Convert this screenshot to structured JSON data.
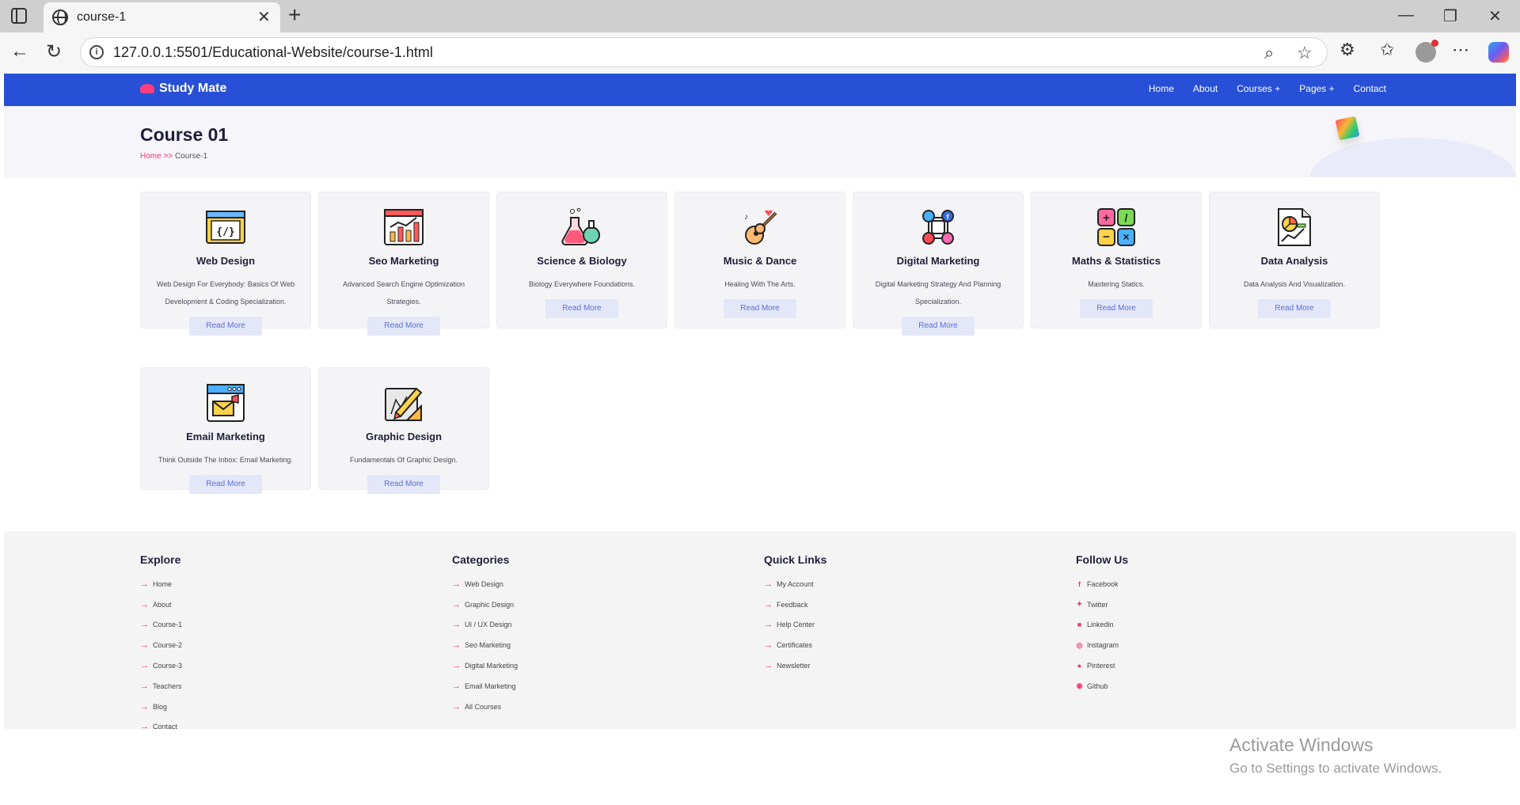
{
  "browser": {
    "tab_title": "course-1",
    "url": "127.0.0.1:5501/Educational-Website/course-1.html"
  },
  "site": {
    "logo": "Study Mate",
    "nav": [
      "Home",
      "About",
      "Courses +",
      "Pages +",
      "Contact"
    ],
    "page_title": "Course 01",
    "breadcrumb": {
      "home": "Home",
      "sep": ">>",
      "current": "Course-1"
    }
  },
  "courses": [
    {
      "title": "Web Design",
      "desc": "Web Design For Everybody: Basics Of Web Development & Coding Specialization.",
      "button": "Read More",
      "icon": "code-window-icon"
    },
    {
      "title": "Seo Marketing",
      "desc": "Advanced Search Engine Optimization Strategies.",
      "button": "Read More",
      "icon": "seo-chart-icon"
    },
    {
      "title": "Science & Biology",
      "desc": "Biology Everywhere Foundations.",
      "button": "Read More",
      "icon": "flask-icon"
    },
    {
      "title": "Music & Dance",
      "desc": "Healing With The Arts.",
      "button": "Read More",
      "icon": "guitar-icon"
    },
    {
      "title": "Digital Marketing",
      "desc": "Digital Marketing Strategy And Planning Specialization.",
      "button": "Read More",
      "icon": "social-network-icon"
    },
    {
      "title": "Maths & Statistics",
      "desc": "Mastering Statics.",
      "button": "Read More",
      "icon": "calculator-icon"
    },
    {
      "title": "Data Analysis",
      "desc": "Data Analysis And Visualization.",
      "button": "Read More",
      "icon": "data-report-icon"
    },
    {
      "title": "Email Marketing",
      "desc": "Think Outside The Inbox: Email Marketing.",
      "button": "Read More",
      "icon": "email-icon"
    },
    {
      "title": "Graphic Design",
      "desc": "Fundamentals Of Graphic Design.",
      "button": "Read More",
      "icon": "design-tools-icon"
    }
  ],
  "footer": {
    "explore": {
      "title": "Explore",
      "items": [
        "Home",
        "About",
        "Course-1",
        "Course-2",
        "Course-3",
        "Teachers",
        "Blog",
        "Contact"
      ]
    },
    "categories": {
      "title": "Categories",
      "items": [
        "Web Design",
        "Graphic Design",
        "UI / UX Design",
        "Seo Marketing",
        "Digital Marketing",
        "Email Marketing",
        "All Courses"
      ]
    },
    "quick_links": {
      "title": "Quick Links",
      "items": [
        "My Account",
        "Feedback",
        "Help Center",
        "Certificates",
        "Newsletter"
      ]
    },
    "follow": {
      "title": "Follow Us",
      "items": [
        "Facebook",
        "Twitter",
        "Linkedin",
        "Instagram",
        "Pinterest",
        "Github"
      ]
    }
  },
  "watermark": {
    "title": "Activate Windows",
    "subtitle": "Go to Settings to activate Windows."
  },
  "colors": {
    "navbar": "#2750d6",
    "accent": "#ff2e74",
    "button_bg": "#e3e7f8",
    "button_text": "#5a6fd6"
  }
}
